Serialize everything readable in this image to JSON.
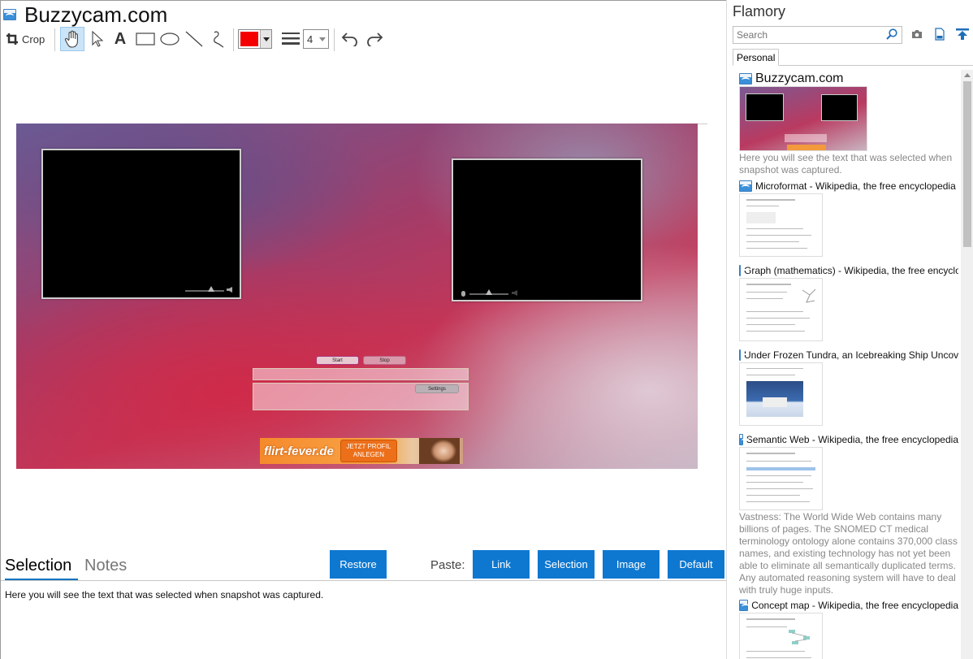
{
  "main": {
    "title": "Buzzycam.com",
    "toolbar": {
      "crop_label": "Crop",
      "stroke_width": "4",
      "color": "#f40000"
    },
    "snapshot": {
      "start_label": "Start",
      "stop_label": "Stop",
      "settings_label": "Settings",
      "ad_brand": "flirt-fever.de",
      "ad_cta": "JETZT PROFIL ANLEGEN"
    },
    "tabs": {
      "selection": "Selection",
      "notes": "Notes"
    },
    "buttons": {
      "restore": "Restore",
      "paste_label": "Paste:",
      "link": "Link",
      "selection": "Selection",
      "image": "Image",
      "default": "Default"
    },
    "selection_text": "Here you will see the text that was selected when snapshot was captured."
  },
  "sidebar": {
    "title": "Flamory",
    "search_placeholder": "Search",
    "tab": "Personal",
    "items": [
      {
        "title": "Buzzycam.com",
        "desc": "Here you will see the text that was selected when snapshot was captured."
      },
      {
        "title": "Microformat - Wikipedia, the free encyclopedia"
      },
      {
        "title": "Graph (mathematics) - Wikipedia, the free encyclopedia"
      },
      {
        "title": "Under Frozen Tundra, an Icebreaking Ship Uncovers"
      },
      {
        "title": "Semantic Web - Wikipedia, the free encyclopedia",
        "desc": "Vastness: The World Wide Web contains many billions of pages. The SNOMED CT medical terminology ontology alone contains 370,000 class names, and existing technology has not yet been able to eliminate all semantically duplicated terms. Any automated reasoning system will have to deal with truly huge inputs."
      },
      {
        "title": "Concept map - Wikipedia, the free encyclopedia"
      }
    ]
  },
  "colors": {
    "accent": "#0e78d0",
    "tab_underline": "#0f72c0"
  }
}
